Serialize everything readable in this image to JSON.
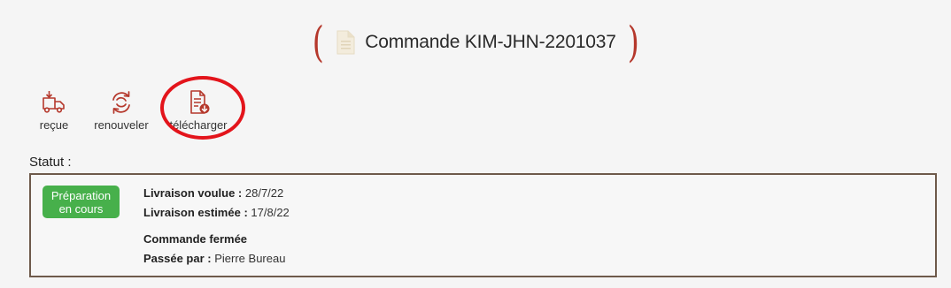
{
  "header": {
    "title": "Commande KIM-JHN-2201037",
    "icon": "document-icon",
    "bracket_color": "#b5382c"
  },
  "actions": [
    {
      "label": "reçue",
      "icon": "delivery-truck-icon"
    },
    {
      "label": "renouveler",
      "icon": "renew-cycle-icon"
    },
    {
      "label": "télécharger",
      "icon": "download-document-icon"
    }
  ],
  "status": {
    "heading": "Statut :",
    "badge": {
      "line1": "Préparation",
      "line2": "en cours",
      "color": "#47b04b"
    },
    "desired_delivery": {
      "label": "Livraison voulue :",
      "value": "28/7/22"
    },
    "estimated_delivery": {
      "label": "Livraison estimée :",
      "value": "17/8/22"
    },
    "closed_text": "Commande fermée",
    "placed_by": {
      "label": "Passée par :",
      "value": "Pierre Bureau"
    }
  },
  "highlight_color": "#e3141b",
  "icon_color": "#b5382c"
}
